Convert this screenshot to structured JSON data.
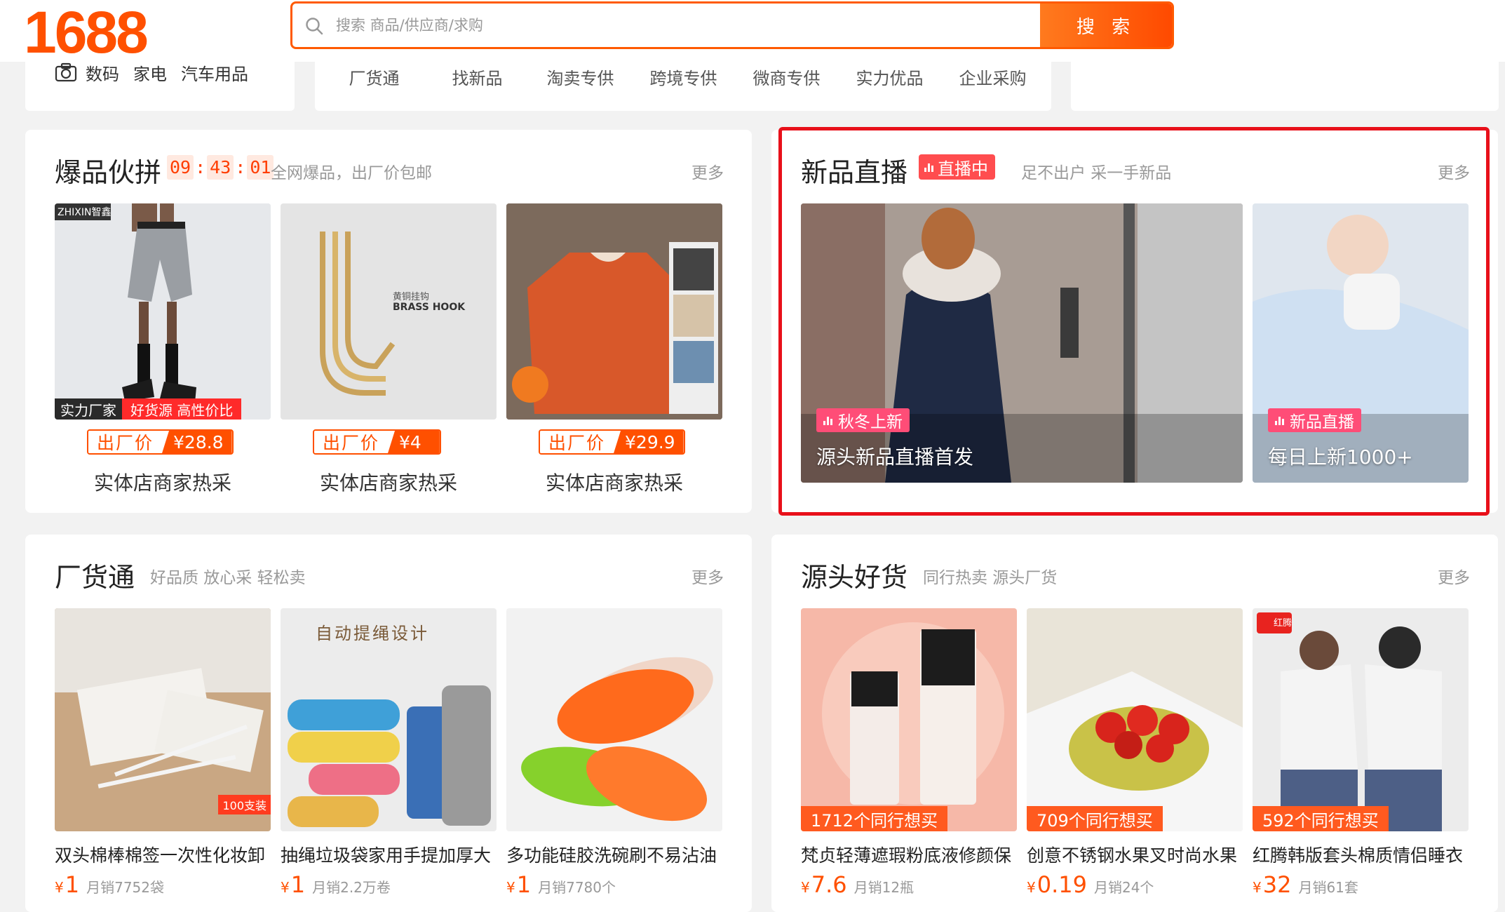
{
  "header": {
    "logo": "1688",
    "search_placeholder": "搜索 商品/供应商/求购",
    "search_button": "搜 索"
  },
  "categories": [
    "数码",
    "家电",
    "汽车用品"
  ],
  "nav": [
    "厂货通",
    "找新品",
    "淘卖专供",
    "跨境专供",
    "微商专供",
    "实力优品",
    "企业采购"
  ],
  "hot": {
    "title": "爆品伙拼",
    "timer": [
      "09",
      "43",
      "01"
    ],
    "timer_sep": ":",
    "subtitle": "全网爆品，出厂价包邮",
    "more": "更多",
    "price_label": "出厂价",
    "image_tag_a": "实力厂家",
    "image_tag_b": "好货源 高性价比",
    "brand_mark": "ZHIXIN智鑫",
    "hook_text_1": "黄铜挂钩",
    "hook_text_2": "BRASS HOOK",
    "items": [
      {
        "price": "¥28.8",
        "caption": "实体店商家热采"
      },
      {
        "price": "¥4",
        "caption": "实体店商家热采"
      },
      {
        "price": "¥29.9",
        "caption": "实体店商家热采"
      }
    ]
  },
  "live": {
    "title": "新品直播",
    "badge": "直播中",
    "subtitle": "足不出户 采一手新品",
    "more": "更多",
    "cards": [
      {
        "tag": "秋冬上新",
        "text": "源头新品直播首发"
      },
      {
        "tag": "新品直播",
        "text": "每日上新1000+"
      }
    ]
  },
  "factory": {
    "title": "厂货通",
    "subtitle": "好品质 放心采 轻松卖",
    "more": "更多",
    "img2_text": "自动提绳设计",
    "img1_badge": "100支装",
    "items": [
      {
        "name": "双头棉棒棉签一次性化妆卸",
        "price": "1",
        "sales": "月销7752袋"
      },
      {
        "name": "抽绳垃圾袋家用手提加厚大",
        "price": "1",
        "sales": "月销2.2万卷"
      },
      {
        "name": "多功能硅胶洗碗刷不易沾油",
        "price": "1",
        "sales": "月销7780个"
      }
    ]
  },
  "source": {
    "title": "源头好货",
    "subtitle": "同行热卖 源头厂货",
    "more": "更多",
    "brand_badge": "红腾",
    "items": [
      {
        "want": "1712个同行想买",
        "name": "梵贞轻薄遮瑕粉底液修颜保",
        "price": "7.6",
        "sales": "月销12瓶"
      },
      {
        "want": "709个同行想买",
        "name": "创意不锈钢水果叉时尚水果",
        "price": "0.19",
        "sales": "月销24个"
      },
      {
        "want": "592个同行想买",
        "name": "红腾韩版套头棉质情侣睡衣",
        "price": "32",
        "sales": "月销61套"
      }
    ]
  },
  "currency": "¥",
  "colors": {
    "brand": "#ff5000",
    "live_red": "#ff4d4f",
    "highlight": "#e8101a"
  }
}
